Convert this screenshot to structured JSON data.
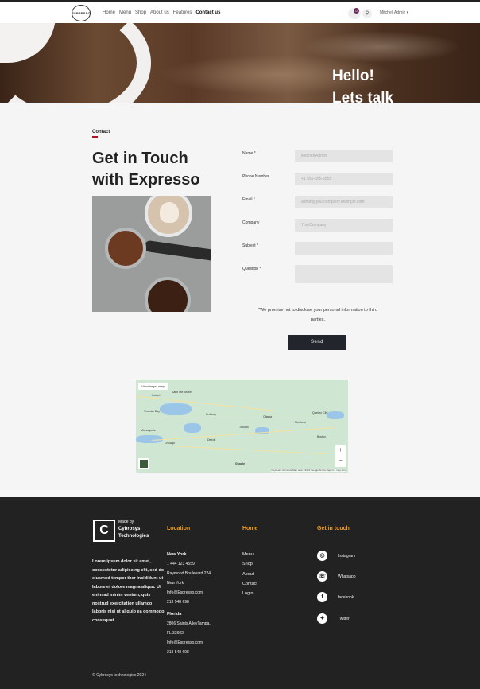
{
  "nav": {
    "logo_text": "ESPRESSO",
    "items": [
      "Home",
      "Menu",
      "Shop",
      "About us",
      "Features",
      "Contact us"
    ],
    "active": "Contact us",
    "cart_count": "0",
    "user": "Mitchell Admin"
  },
  "hero": {
    "line1": "Hello!",
    "line2": "Lets talk"
  },
  "contact": {
    "crumb": "Contact",
    "heading_line1": "Get in Touch",
    "heading_line2": "with Expresso",
    "fields": [
      {
        "label": "Name *",
        "value": "Mitchell Admin"
      },
      {
        "label": "Phone Number",
        "value": "+1 555-555-5555"
      },
      {
        "label": "Email *",
        "value": "admin@yourcompany.example.com"
      },
      {
        "label": "Company",
        "value": "YourCompany"
      },
      {
        "label": "Subject *",
        "value": ""
      },
      {
        "label": "Question *",
        "value": ""
      }
    ],
    "privacy": "*We promise not to disclose your personal information to third parties.",
    "send": "Send"
  },
  "map": {
    "view_larger": "View larger map",
    "zoom_in": "+",
    "zoom_out": "−",
    "attribution": "Keyboard shortcuts   Map data ©2024 Google   Terms   Report a map error",
    "brand": "Google",
    "towns": [
      "Oxford",
      "Sault Ste. Marie",
      "Thunder Bay",
      "Sudbury",
      "Toronto",
      "Ottawa",
      "Montreal",
      "Quebec City",
      "Minneapolis",
      "Chicago",
      "Detroit",
      "Boston"
    ]
  },
  "footer": {
    "made_by": "Made by",
    "company_line1": "Cybrosys",
    "company_line2": "Technologies",
    "lorem": "Lorem ipsum dolor sit amet, consectetur adipiscing elit, sed do eiusmod tempor ther incididunt ut labore et dolore magna aliqua. Ut enim ad minim veniam, quis nostrud exercitation ullamco laboris nisi ut aliquip ea commodo consequat.",
    "location_title": "Location",
    "ny_title": "New York",
    "ny_phone": "1 444 123 4559",
    "ny_addr1": "Raymond Boulevard 224,",
    "ny_addr2": "New York",
    "ny_email": "Info@Espresso.com",
    "ny_phone2": "213 548 698",
    "fl_title": "Florida",
    "fl_addr1": "2806 Saints AlleyTampa,",
    "fl_addr2": "FL 33602",
    "fl_email": "Info@Espresso.com",
    "fl_phone": "213 548 698",
    "home_title": "Home",
    "links": [
      "Menu",
      "Shop",
      "About",
      "Contact",
      "Login"
    ],
    "touch_title": "Get in touch",
    "social": [
      "Instagram",
      "Whatsapp",
      "facebook",
      "Twitter"
    ],
    "copyright": "© Cybrosys technologies 2024"
  }
}
